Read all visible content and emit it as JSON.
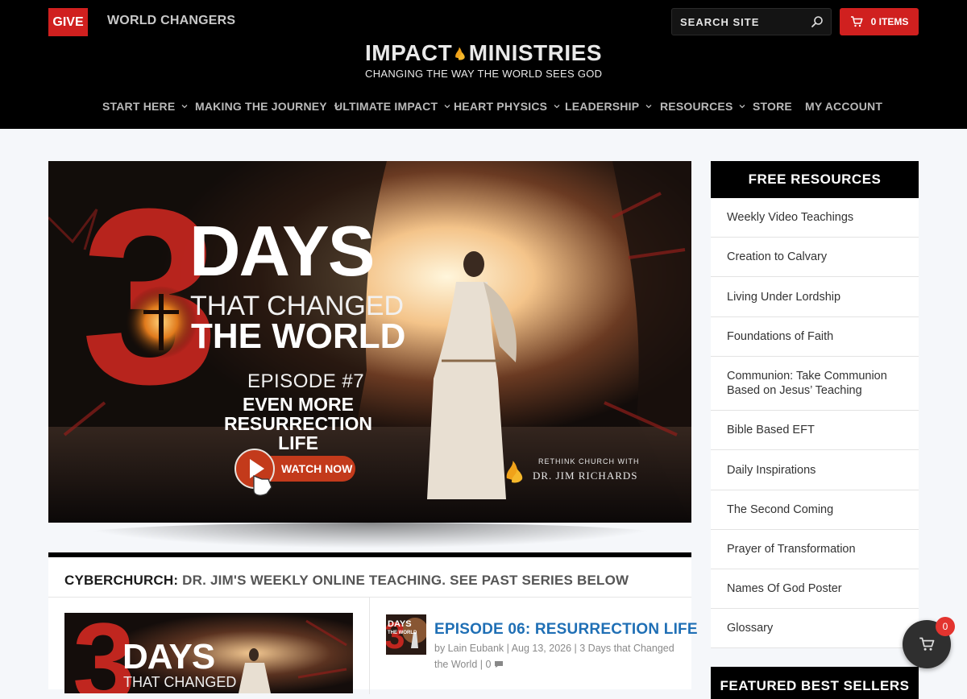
{
  "header": {
    "give_label": "GIVE",
    "world_changers_label": "WORLD CHANGERS",
    "search_placeholder": "SEARCH SITE",
    "cart_label": "0 ITEMS",
    "logo": {
      "main_left": "IMPACT",
      "main_right": "MINISTRIES",
      "tagline": "CHANGING THE WAY THE WORLD SEES GOD"
    },
    "nav": [
      {
        "label": "START HERE",
        "has_dropdown": true
      },
      {
        "label": "MAKING THE JOURNEY",
        "has_dropdown": true
      },
      {
        "label": "ULTIMATE IMPACT",
        "has_dropdown": true
      },
      {
        "label": "HEART PHYSICS",
        "has_dropdown": true
      },
      {
        "label": "LEADERSHIP",
        "has_dropdown": true
      },
      {
        "label": "RESOURCES",
        "has_dropdown": true
      },
      {
        "label": "STORE",
        "has_dropdown": false
      },
      {
        "label": "MY ACCOUNT",
        "has_dropdown": false
      }
    ]
  },
  "hero": {
    "numeral": "3",
    "days": "DAYS",
    "that_changed": "THAT CHANGED",
    "the_world": "THE WORLD",
    "episode": "EPISODE #7",
    "subtitle_line1": "EVEN MORE",
    "subtitle_line2": "RESURRECTION LIFE",
    "watch_label": "WATCH NOW",
    "rethink_line1": "RETHINK CHURCH WITH",
    "rethink_line2": "DR. JIM RICHARDS"
  },
  "section": {
    "title_bold": "CYBERCHURCH:",
    "title_rest": " DR. JIM'S WEEKLY ONLINE TEACHING. SEE PAST SERIES BELOW",
    "post": {
      "title": "EPISODE 06: RESURRECTION LIFE",
      "meta": "by Lain Eubank | Aug 13, 2026 | 3 Days that Changed the World | 0",
      "thumb_days": "DAYS",
      "thumb_changed": "THAT CHANGED",
      "mini_days": "DAYS",
      "mini_world": "THE WORLD"
    }
  },
  "sidebar": {
    "title": "FREE RESOURCES",
    "items": [
      "Weekly Video Teachings",
      "Creation to Calvary",
      "Living Under Lordship",
      "Foundations of Faith",
      "Communion: Take Communion Based on Jesus’ Teaching",
      "Bible Based EFT",
      "Daily Inspirations",
      "The Second Coming",
      "Prayer of Transformation",
      "Names Of God Poster",
      "Glossary"
    ],
    "second_title": "FEATURED BEST SELLERS"
  },
  "floating_cart": {
    "count": "0"
  },
  "colors": {
    "brand_red": "#d0201f",
    "link_blue": "#1f6fb5",
    "header_bg": "#000000"
  }
}
